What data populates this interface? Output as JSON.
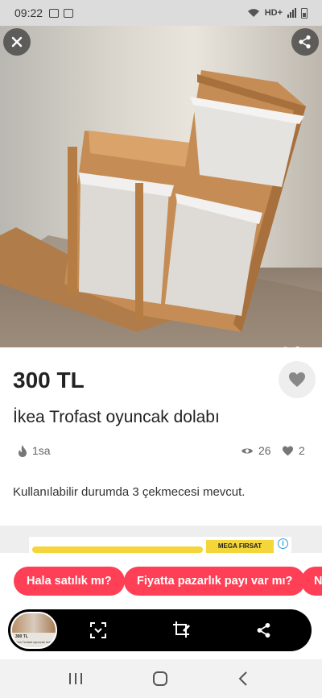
{
  "status_bar": {
    "time": "09:22",
    "network": "HD+"
  },
  "photo": {
    "page_index": 2,
    "page_count": 2
  },
  "listing": {
    "price": "300 TL",
    "title": "İkea Trofast oyuncak dolabı",
    "posted_ago": "1sa",
    "views": "26",
    "likes": "2",
    "description": "Kullanılabilir durumda 3 çekmecesi mevcut."
  },
  "ad": {
    "banner_text": "MEGA FIRSAT PAKETİ"
  },
  "quick_replies": [
    {
      "label": "Hala satılık mı?"
    },
    {
      "label": "Fiyatta pazarlık payı var mı?"
    },
    {
      "label": "N"
    }
  ],
  "toolbar_thumbnail": {
    "price": "300 TL",
    "title": "İkea Trofast oyuncak dolabı"
  },
  "icons": {
    "close": "close-icon",
    "share": "share-icon",
    "favorite": "heart-icon",
    "time": "flame-icon",
    "views": "eye-icon",
    "likes": "heart-icon",
    "scan": "scan-icon",
    "crop_edit": "crop-edit-icon",
    "toolbar_share": "share-icon"
  },
  "colors": {
    "accent": "#ff3f55",
    "status_bar_bg": "#dcdcdc",
    "toolbar_bg": "#000000"
  }
}
